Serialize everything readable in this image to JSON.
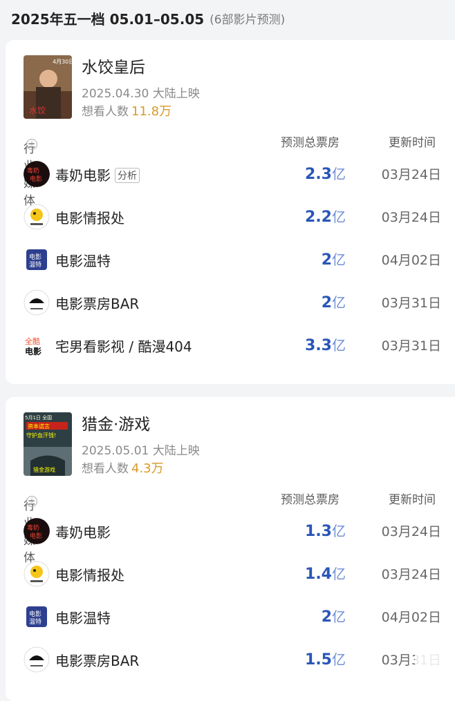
{
  "header": {
    "title": "2025年五一档 05.01–05.05",
    "subtitle": "(6部影片预测)"
  },
  "table_headers": {
    "media": "行业媒体",
    "box": "预测总票房",
    "time": "更新时间"
  },
  "movies": [
    {
      "title": "水饺皇后",
      "date": "2025.04.30 大陆上映",
      "want_label": "想看人数",
      "want_value": "11.8万",
      "rows": [
        {
          "name": "毒奶电影",
          "tag": "分析",
          "value": "2.3",
          "unit": "亿",
          "time": "03月24日"
        },
        {
          "name": "电影情报处",
          "value": "2.2",
          "unit": "亿",
          "time": "03月24日"
        },
        {
          "name": "电影温特",
          "value": "2",
          "unit": "亿",
          "time": "04月02日"
        },
        {
          "name": "电影票房BAR",
          "value": "2",
          "unit": "亿",
          "time": "03月31日"
        },
        {
          "name": "宅男看影视 / 酷漫404",
          "value": "3.3",
          "unit": "亿",
          "time": "03月31日"
        }
      ]
    },
    {
      "title": "猎金·游戏",
      "date": "2025.05.01 大陆上映",
      "want_label": "想看人数",
      "want_value": "4.3万",
      "rows": [
        {
          "name": "毒奶电影",
          "value": "1.3",
          "unit": "亿",
          "time": "03月24日"
        },
        {
          "name": "电影情报处",
          "value": "1.4",
          "unit": "亿",
          "time": "03月24日"
        },
        {
          "name": "电影温特",
          "value": "2",
          "unit": "亿",
          "time": "04月02日"
        },
        {
          "name": "电影票房BAR",
          "value": "1.5",
          "unit": "亿",
          "time": "03月31日"
        }
      ]
    }
  ]
}
